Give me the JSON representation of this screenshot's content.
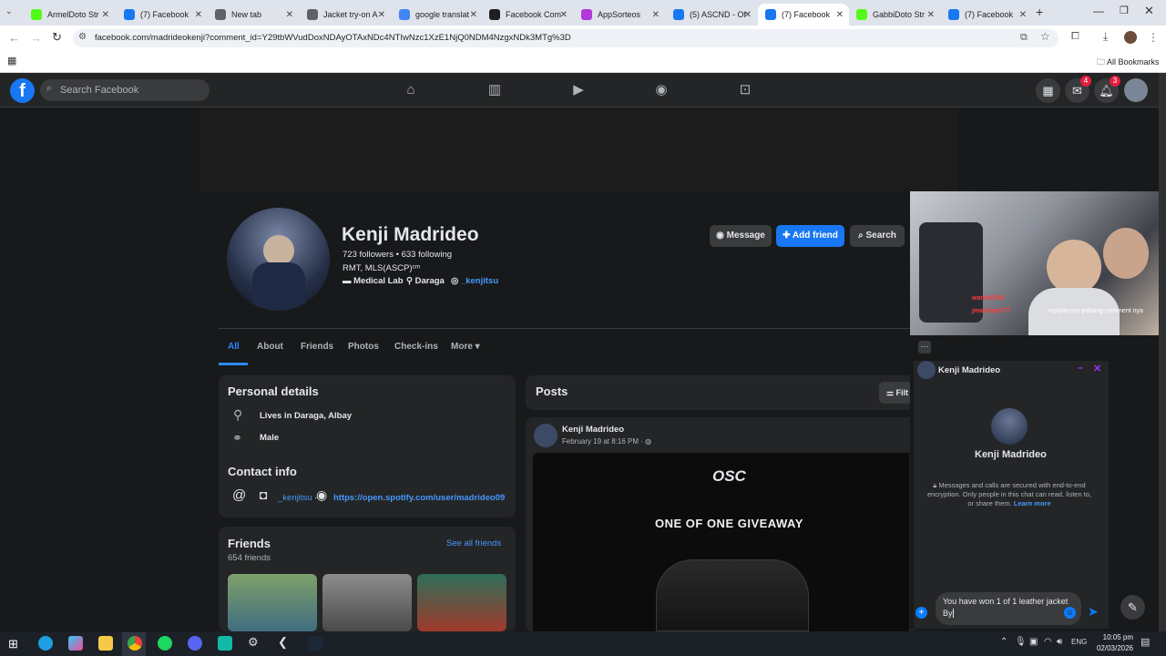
{
  "browser": {
    "tabs": [
      {
        "title": "ArmelDoto Str",
        "color": "#53fc18"
      },
      {
        "title": "(7) Facebook",
        "color": "#1877f2"
      },
      {
        "title": "New tab",
        "color": "#5f6368"
      },
      {
        "title": "Jacket try-on A",
        "color": "#5f6368"
      },
      {
        "title": "google translat",
        "color": "#4285f4"
      },
      {
        "title": "Facebook Com",
        "color": "#1f1f1f"
      },
      {
        "title": "AppSorteos",
        "color": "#b23ad8"
      },
      {
        "title": "(5) ASCND - Of",
        "color": "#1877f2"
      },
      {
        "title": "(7) Facebook",
        "color": "#1877f2"
      },
      {
        "title": "GabbiDoto Str",
        "color": "#53fc18"
      },
      {
        "title": "(7) Facebook",
        "color": "#1877f2"
      }
    ],
    "url": "facebook.com/madrideokenji?comment_id=Y29tbWVudDoxNDAyOTAxNDc4NTIwNzc1XzE1NjQ0NDM4NzgxNDk3MTg%3D",
    "bookmarks_label": "All Bookmarks"
  },
  "fb": {
    "logo": "f",
    "search_placeholder": "Search Facebook",
    "messenger_badge": "4",
    "notif_badge": "3"
  },
  "profile": {
    "name": "Kenji Madrideo",
    "stats": "723 followers • 633 following",
    "title": "RMT, MLS(ASCP)ᶜᵐ",
    "work": "Medical Lab",
    "location": "Daraga",
    "instagram": "_kenjitsu",
    "message_btn": "Message",
    "add_friend_btn": "Add friend",
    "search_btn": "Search"
  },
  "tabs": [
    "All",
    "About",
    "Friends",
    "Photos",
    "Check-ins",
    "More ▾"
  ],
  "details": {
    "heading": "Personal details",
    "lives": "Lives in Daraga, Albay",
    "gender": "Male",
    "contact_heading": "Contact info",
    "ig": "_kenjitsu",
    "sep": "·",
    "spotify": "https://open.spotify.com/user/madrideo09"
  },
  "friends": {
    "heading": "Friends",
    "count": "654 friends",
    "see_all": "See all friends"
  },
  "posts": {
    "heading": "Posts",
    "filter": "Filt",
    "author": "Kenji Madrideo",
    "date": "February 19 at 8:16 PM · ",
    "brand": "OSC",
    "giveaway": "ONE OF ONE GIVEAWAY"
  },
  "webcam": {
    "chat1": "wardell330",
    "chat2": "jmardrop777",
    "chat3": "replyan mo pahang comment nya"
  },
  "chat": {
    "more": "···",
    "header_name": "Kenji Madrideo",
    "contact_name": "Kenji Madrideo",
    "encryption": "Messages and calls are secured with end-to-end encryption. Only people in this chat can read, listen to, or share them.",
    "learn_more": "Learn more",
    "draft": "You have won 1 of 1 leather jacket By "
  },
  "taskbar": {
    "lang": "ENG",
    "time": "10:05 pm",
    "date": "02/03/2026"
  }
}
